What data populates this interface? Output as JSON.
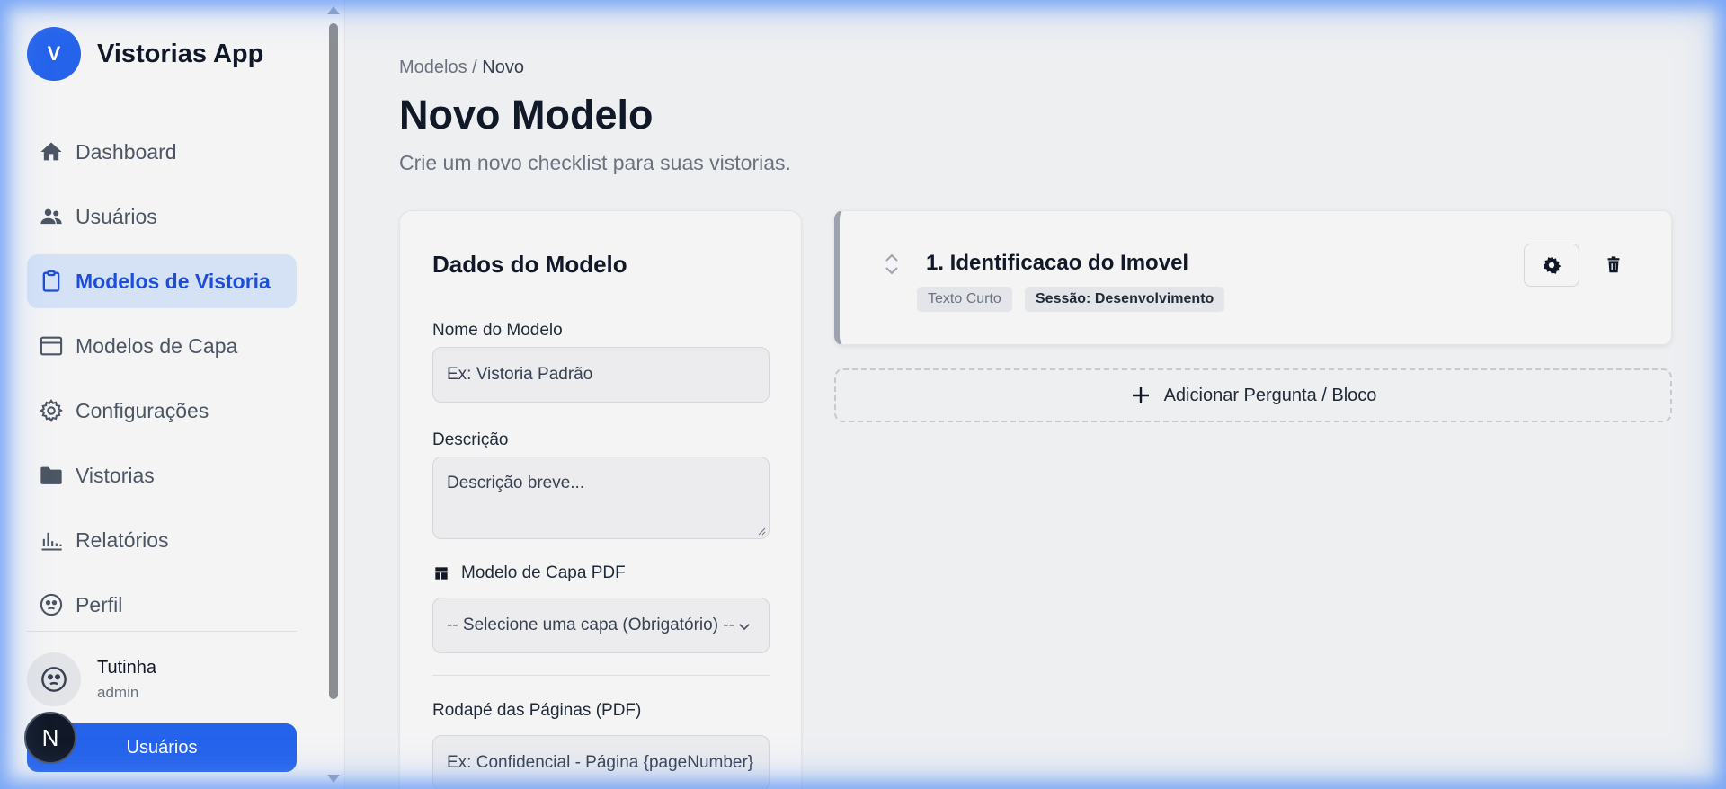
{
  "app": {
    "logo_letter": "V",
    "name": "Vistorias App"
  },
  "sidebar": {
    "items": [
      {
        "label": "Dashboard",
        "icon": "home-icon"
      },
      {
        "label": "Usuários",
        "icon": "users-icon"
      },
      {
        "label": "Modelos de Vistoria",
        "icon": "clipboard-icon",
        "active": true
      },
      {
        "label": "Modelos de Capa",
        "icon": "window-icon"
      },
      {
        "label": "Configurações",
        "icon": "gear-icon"
      },
      {
        "label": "Vistorias",
        "icon": "folder-icon"
      },
      {
        "label": "Relatórios",
        "icon": "bar-chart-icon"
      },
      {
        "label": "Perfil",
        "icon": "face-icon"
      }
    ],
    "user": {
      "name": "Tutinha",
      "role": "admin"
    },
    "user_button_label": "Usuários",
    "next_badge": "N"
  },
  "breadcrumb": {
    "parent": "Modelos",
    "separator": "/",
    "current": "Novo"
  },
  "page": {
    "title": "Novo Modelo",
    "subtitle": "Crie um novo checklist para suas vistorias."
  },
  "form": {
    "title": "Dados do Modelo",
    "name_label": "Nome do Modelo",
    "name_placeholder": "Ex: Vistoria Padrão",
    "desc_label": "Descrição",
    "desc_placeholder": "Descrição breve...",
    "cover_label": "Modelo de Capa PDF",
    "cover_selected": "-- Selecione uma capa (Obrigatório) --",
    "footer_label": "Rodapé das Páginas (PDF)",
    "footer_placeholder": "Ex: Confidencial - Página {pageNumber}"
  },
  "question": {
    "title": "1. Identificacao do Imovel",
    "type_badge": "Texto Curto",
    "session_badge": "Sessão: Desenvolvimento"
  },
  "add_button_label": "Adicionar Pergunta / Bloco",
  "colors": {
    "accent": "#2563eb",
    "active_bg": "#d5e2f6",
    "active_text": "#1d4ed8"
  }
}
